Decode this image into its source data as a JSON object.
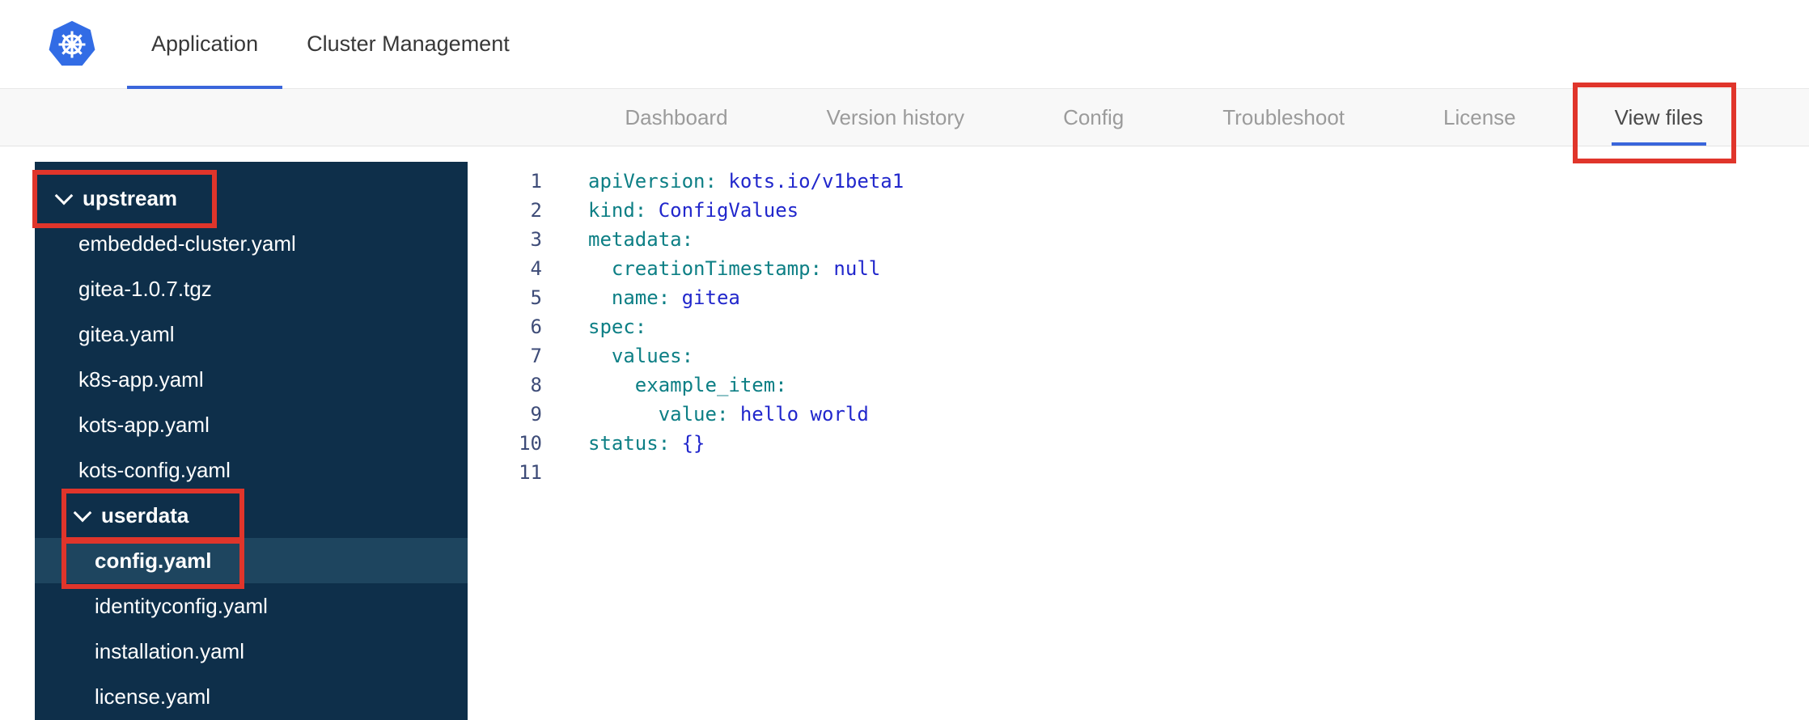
{
  "header": {
    "tabs": [
      {
        "label": "Application",
        "active": true
      },
      {
        "label": "Cluster Management",
        "active": false
      }
    ]
  },
  "nav": {
    "items": [
      "Dashboard",
      "Version history",
      "Config",
      "Troubleshoot",
      "License",
      "View files"
    ],
    "active": "View files"
  },
  "file_tree": {
    "items": [
      {
        "type": "folder",
        "label": "upstream",
        "level": 0,
        "expanded": true
      },
      {
        "type": "file",
        "label": "embedded-cluster.yaml",
        "level": 0
      },
      {
        "type": "file",
        "label": "gitea-1.0.7.tgz",
        "level": 0
      },
      {
        "type": "file",
        "label": "gitea.yaml",
        "level": 0
      },
      {
        "type": "file",
        "label": "k8s-app.yaml",
        "level": 0
      },
      {
        "type": "file",
        "label": "kots-app.yaml",
        "level": 0
      },
      {
        "type": "file",
        "label": "kots-config.yaml",
        "level": 0
      },
      {
        "type": "folder",
        "label": "userdata",
        "level": 1,
        "expanded": true
      },
      {
        "type": "file",
        "label": "config.yaml",
        "level": 1,
        "selected": true
      },
      {
        "type": "file",
        "label": "identityconfig.yaml",
        "level": 1
      },
      {
        "type": "file",
        "label": "installation.yaml",
        "level": 1
      },
      {
        "type": "file",
        "label": "license.yaml",
        "level": 1
      }
    ]
  },
  "editor": {
    "lines": [
      {
        "num": 1,
        "tokens": [
          {
            "c": "key",
            "v": "apiVersion:"
          },
          {
            "c": "val",
            "v": " kots.io/v1beta1"
          }
        ]
      },
      {
        "num": 2,
        "tokens": [
          {
            "c": "key",
            "v": "kind:"
          },
          {
            "c": "val",
            "v": " ConfigValues"
          }
        ]
      },
      {
        "num": 3,
        "tokens": [
          {
            "c": "key",
            "v": "metadata:"
          }
        ]
      },
      {
        "num": 4,
        "tokens": [
          {
            "c": "key",
            "v": "  creationTimestamp:"
          },
          {
            "c": "val",
            "v": " null"
          }
        ]
      },
      {
        "num": 5,
        "tokens": [
          {
            "c": "key",
            "v": "  name:"
          },
          {
            "c": "val",
            "v": " gitea"
          }
        ]
      },
      {
        "num": 6,
        "tokens": [
          {
            "c": "key",
            "v": "spec:"
          }
        ]
      },
      {
        "num": 7,
        "tokens": [
          {
            "c": "key",
            "v": "  values:"
          }
        ]
      },
      {
        "num": 8,
        "tokens": [
          {
            "c": "key",
            "v": "    example_item:"
          }
        ]
      },
      {
        "num": 9,
        "tokens": [
          {
            "c": "key",
            "v": "      value:"
          },
          {
            "c": "val",
            "v": " hello world"
          }
        ]
      },
      {
        "num": 10,
        "tokens": [
          {
            "c": "key",
            "v": "status:"
          },
          {
            "c": "val",
            "v": " {}"
          }
        ]
      },
      {
        "num": 11,
        "tokens": []
      }
    ]
  },
  "annotations": {
    "color": "#e0352b",
    "targets": [
      "view-files-tab",
      "upstream-folder",
      "userdata-folder",
      "config-yaml-file"
    ]
  },
  "colors": {
    "accent_blue": "#3a66db",
    "sidebar_bg": "#0e2f4a",
    "sidebar_selected": "#1e455f",
    "yaml_key": "#0d7f85",
    "yaml_value": "#2127cc"
  }
}
